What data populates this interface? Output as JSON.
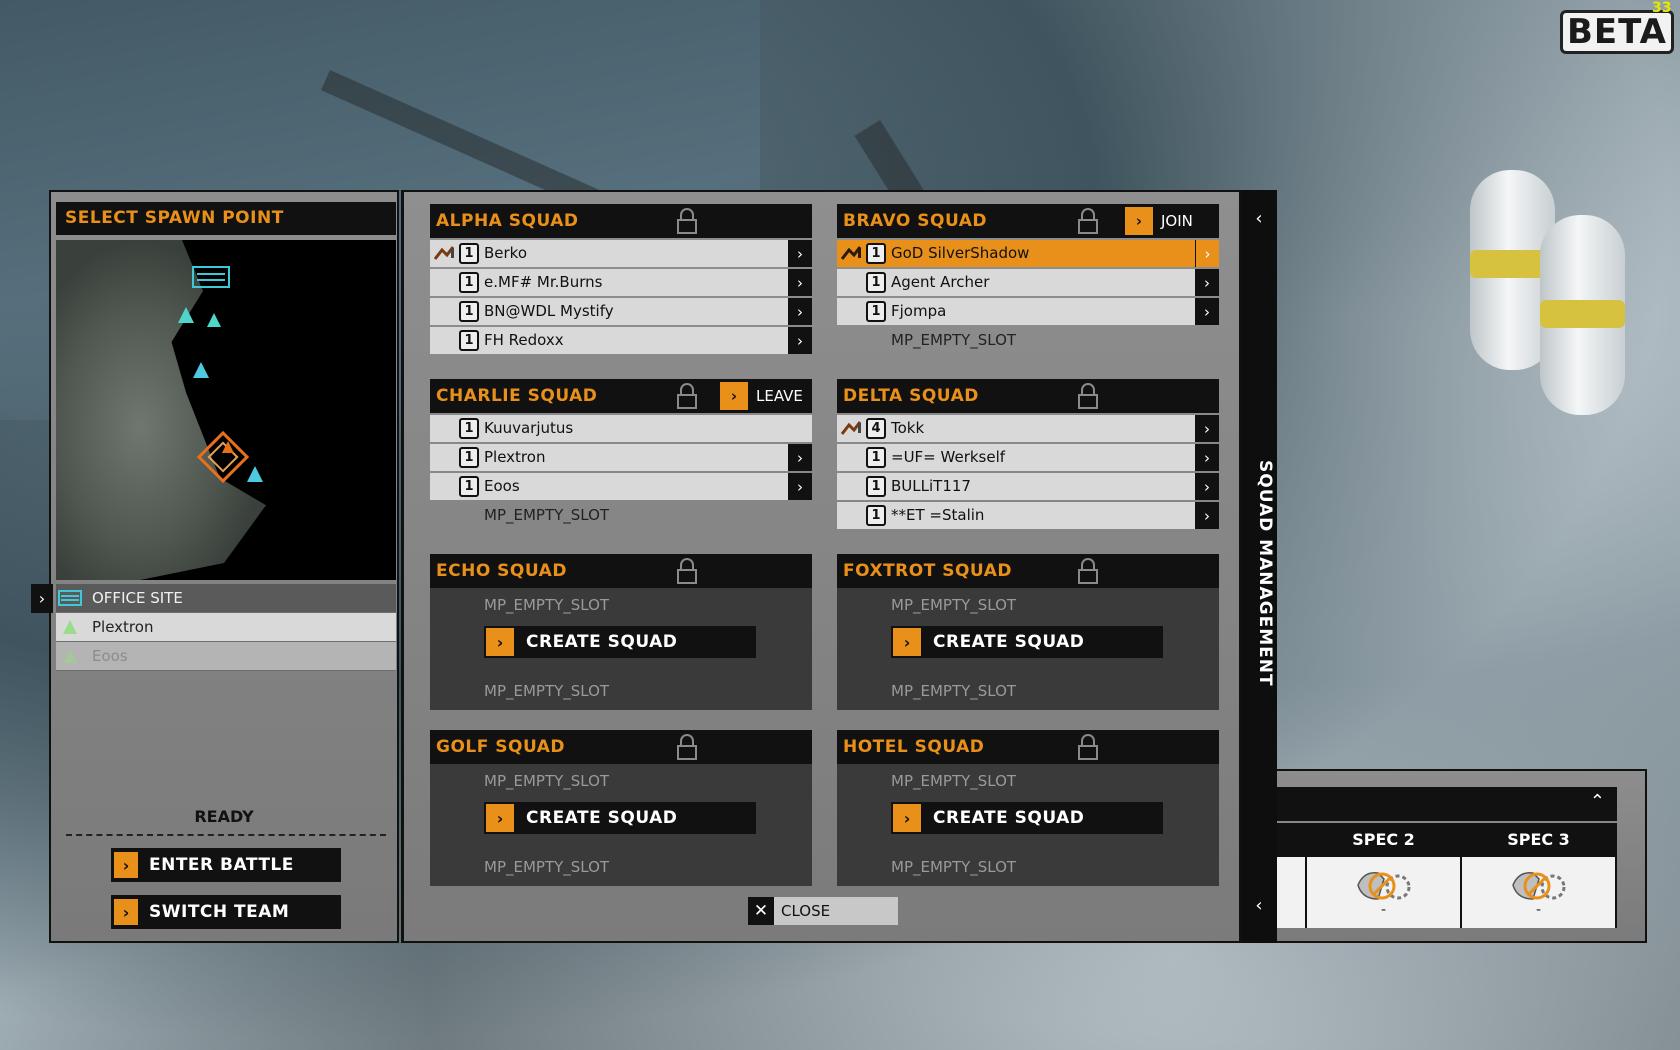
{
  "hud": {
    "beta_label": "BETA",
    "fps": "33"
  },
  "spawn": {
    "title": "SELECT SPAWN POINT",
    "points": [
      {
        "label": "OFFICE SITE",
        "state": "active"
      },
      {
        "label": "Plextron",
        "state": "normal"
      },
      {
        "label": "Eoos",
        "state": "dim"
      }
    ],
    "ready_label": "READY",
    "enter_battle_label": "ENTER BATTLE",
    "switch_team_label": "SWITCH TEAM"
  },
  "squad_management": {
    "title": "SQUAD MANAGEMENT",
    "close_label": "CLOSE",
    "empty_slot": "MP_EMPTY_SLOT",
    "create_label": "CREATE SQUAD",
    "squads": {
      "alpha": {
        "name": "ALPHA SQUAD",
        "members": [
          {
            "num": "1",
            "name": "Berko"
          },
          {
            "num": "1",
            "name": "e.MF# Mr.Burns"
          },
          {
            "num": "1",
            "name": "BN@WDL Mystify"
          },
          {
            "num": "1",
            "name": "FH Redoxx"
          }
        ]
      },
      "bravo": {
        "name": "BRAVO SQUAD",
        "action": "JOIN",
        "members": [
          {
            "num": "1",
            "name": "GoD SilverShadow"
          },
          {
            "num": "1",
            "name": "Agent Archer"
          },
          {
            "num": "1",
            "name": "Fjompa"
          }
        ],
        "empty": "MP_EMPTY_SLOT"
      },
      "charlie": {
        "name": "CHARLIE SQUAD",
        "action": "LEAVE",
        "members": [
          {
            "num": "1",
            "name": "Kuuvarjutus"
          },
          {
            "num": "1",
            "name": "Plextron"
          },
          {
            "num": "1",
            "name": "Eoos"
          }
        ],
        "empty": "MP_EMPTY_SLOT"
      },
      "delta": {
        "name": "DELTA SQUAD",
        "members": [
          {
            "num": "4",
            "name": "Tokk"
          },
          {
            "num": "1",
            "name": "=UF= Werkself"
          },
          {
            "num": "1",
            "name": "BULLiT117"
          },
          {
            "num": "1",
            "name": "**ET =Stalin"
          }
        ]
      },
      "echo": {
        "name": "ECHO SQUAD"
      },
      "foxtrot": {
        "name": "FOXTROT SQUAD"
      },
      "golf": {
        "name": "GOLF SQUAD"
      },
      "hotel": {
        "name": "HOTEL SQUAD"
      }
    }
  },
  "specs": {
    "cols": [
      {
        "label": "SPEC 2",
        "value": "-"
      },
      {
        "label": "SPEC 3",
        "value": "-"
      }
    ]
  },
  "colors": {
    "accent": "#e8901a",
    "panel": "#858585",
    "bar": "#111111"
  }
}
